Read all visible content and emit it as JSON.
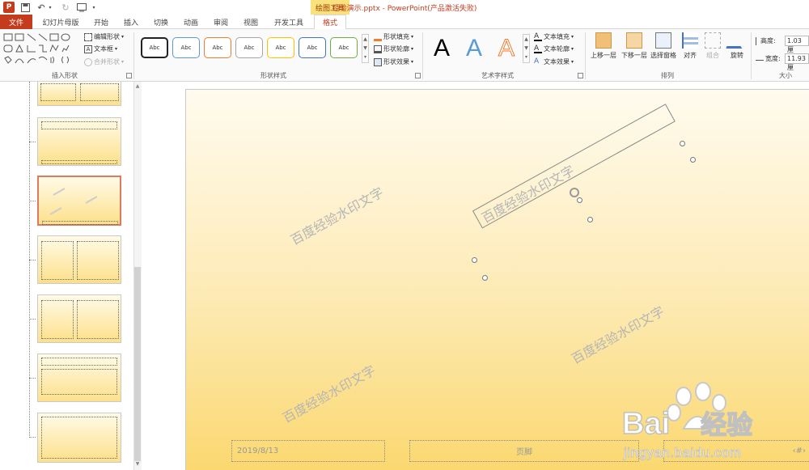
{
  "titlebar": {
    "title": "经验演示.pptx - PowerPoint(产品激活失败)",
    "contextual_tab": "绘图工具"
  },
  "tabs": [
    {
      "label": "文件"
    },
    {
      "label": "幻灯片母版"
    },
    {
      "label": "开始"
    },
    {
      "label": "插入"
    },
    {
      "label": "切换"
    },
    {
      "label": "动画"
    },
    {
      "label": "审阅"
    },
    {
      "label": "视图"
    },
    {
      "label": "开发工具"
    },
    {
      "label": "格式"
    }
  ],
  "ribbon": {
    "insert_shapes": {
      "label": "插入形状",
      "edit_shape": "编辑形状",
      "text_box": "文本框",
      "merge_shapes": "合并形状"
    },
    "shape_styles": {
      "label": "形状样式",
      "preset": "Abc",
      "fill": "形状填充",
      "outline": "形状轮廓",
      "effects": "形状效果",
      "preset_colors": [
        "#222222",
        "#5b9bd5",
        "#ed7d31",
        "#a5a5a5",
        "#ffc000",
        "#4472c4",
        "#70ad47"
      ]
    },
    "wordart": {
      "label": "艺术字样式",
      "sample": "A",
      "text_fill": "文本填充",
      "text_outline": "文本轮廓",
      "text_effects": "文本效果"
    },
    "arrange": {
      "label": "排列",
      "bring_forward": "上移一层",
      "send_backward": "下移一层",
      "selection_pane": "选择窗格",
      "align": "对齐",
      "group": "组合",
      "rotate": "旋转"
    },
    "size": {
      "label": "大小",
      "height_label": "高度:",
      "height_value": "1.03 厘",
      "width_label": "宽度:",
      "width_value": "11.93 厘"
    }
  },
  "slide": {
    "watermark_text": "百度经验水印文字",
    "date": "2019/8/13",
    "footer": "页脚",
    "page_number": "‹#›"
  },
  "branding": {
    "logo_text": "Bai",
    "logo_suffix": "经验",
    "url": "jingyan.baidu.com"
  },
  "colors": {
    "accent": "#c43b1d",
    "slide_top": "#fffbef",
    "slide_bottom": "#fbd870",
    "watermark": "#b5b5b5"
  }
}
